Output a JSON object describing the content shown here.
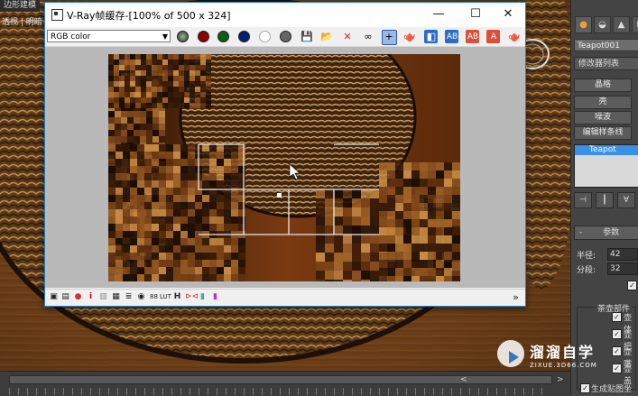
{
  "viewport": {
    "top_label": "边形建模",
    "view_label": "透视 | 明暗"
  },
  "vfb": {
    "title": "V-Ray帧缓存-[100% of 500 x 324]",
    "channel": "RGB color",
    "toolbar_icons": [
      "red-channel-icon",
      "red-dot-icon",
      "green-dot-icon",
      "blue-dot-icon",
      "white-dot-icon",
      "alpha-icon",
      "save-icon",
      "open-icon",
      "clear-icon",
      "link-icon",
      "region-icon",
      "teapot-render-icon",
      "compare-icon",
      "ab-icon",
      "ab-horizontal-icon",
      "ab-vertical-icon",
      "render-teapot-icon"
    ],
    "status_icons": [
      "display-icon",
      "list-icon",
      "color-icon",
      "info-icon",
      "levels-icon",
      "history-icon",
      "lut-circle-icon",
      "srgb-icon",
      "lut-icon",
      "h-icon",
      "compare-icon",
      "lens-icon",
      "stamp-icon"
    ]
  },
  "command_panel": {
    "tabs": [
      "●",
      "◒",
      "▲",
      "⊞"
    ],
    "object_name": "Teapot001",
    "modifier_list": "修改器列表",
    "buttons": [
      "晶格",
      "壳",
      "噪波",
      "编辑样条线"
    ],
    "stack_item": "Teapot",
    "rollout": "参数",
    "radius_label": "半径:",
    "radius_value": "42",
    "segments_label": "分段:",
    "segments_value": "32",
    "group_title": "茶壶部件",
    "parts": [
      "壶体",
      "壶把",
      "壶嘴",
      "壶盖"
    ],
    "bottom_label": "生成贴图坐标"
  },
  "timeline": {
    "left_arrow": "<",
    "right_arrow": ">"
  },
  "watermark": {
    "text": "溜溜自学",
    "sub": "ZIXUE.3D66.COM"
  }
}
